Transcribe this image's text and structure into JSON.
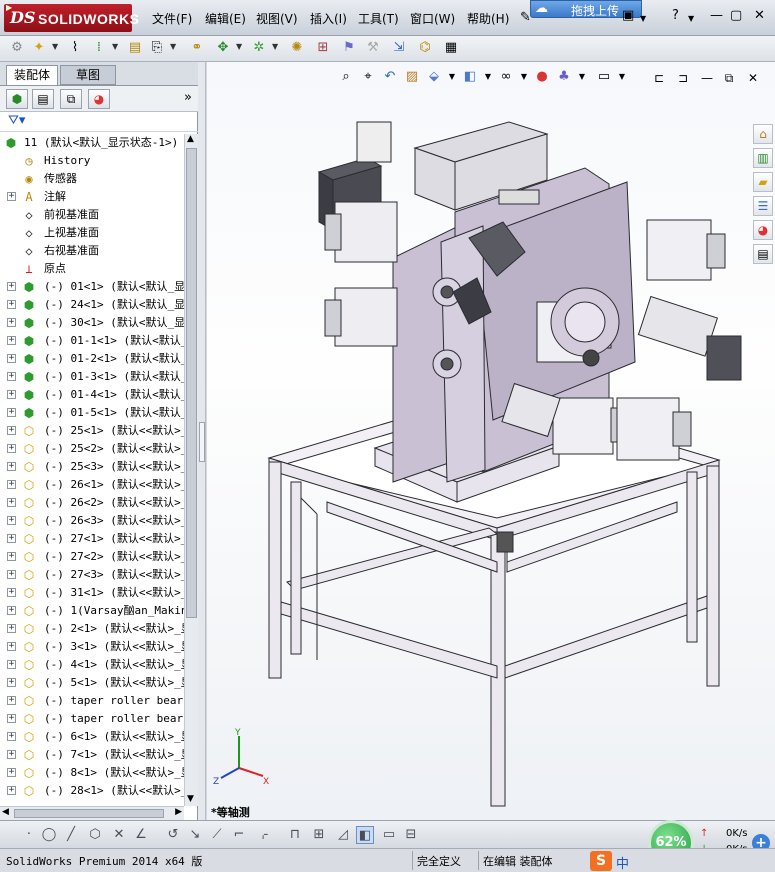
{
  "app": {
    "logo_ds": "DS",
    "logo_name": "SOLIDWORKS"
  },
  "menu": [
    {
      "label": "文件(F)"
    },
    {
      "label": "编辑(E)"
    },
    {
      "label": "视图(V)"
    },
    {
      "label": "插入(I)"
    },
    {
      "label": "工具(T)"
    },
    {
      "label": "窗口(W)"
    },
    {
      "label": "帮助(H)"
    }
  ],
  "upload_widget": {
    "label": "拖拽上传"
  },
  "title_controls": {
    "help": "?",
    "minimize": "—",
    "restore": "▢",
    "close": "✕"
  },
  "left_tabs": {
    "assembly": "装配体",
    "sketch": "草图"
  },
  "tree": {
    "root": "11  (默认<默认_显示状态-1>)",
    "items": [
      {
        "expand": "",
        "icon": "history-icon",
        "label": "History"
      },
      {
        "expand": "",
        "icon": "sensor-icon",
        "label": "传感器"
      },
      {
        "expand": "+",
        "icon": "annotation-icon",
        "label": "注解"
      },
      {
        "expand": "",
        "icon": "plane-icon",
        "label": "前视基准面"
      },
      {
        "expand": "",
        "icon": "plane-icon",
        "label": "上视基准面"
      },
      {
        "expand": "",
        "icon": "plane-icon",
        "label": "右视基准面"
      },
      {
        "expand": "",
        "icon": "origin-icon",
        "label": "原点"
      },
      {
        "expand": "+",
        "icon": "subassembly-icon",
        "label": "(-) 01<1> (默认<默认_显"
      },
      {
        "expand": "+",
        "icon": "subassembly-icon",
        "label": "(-) 24<1> (默认<默认_显"
      },
      {
        "expand": "+",
        "icon": "subassembly-icon",
        "label": "(-) 30<1> (默认<默认_显"
      },
      {
        "expand": "+",
        "icon": "subassembly-icon",
        "label": "(-) 01-1<1> (默认<默认_"
      },
      {
        "expand": "+",
        "icon": "subassembly-icon",
        "label": "(-) 01-2<1> (默认<默认_"
      },
      {
        "expand": "+",
        "icon": "subassembly-icon",
        "label": "(-) 01-3<1> (默认<默认_"
      },
      {
        "expand": "+",
        "icon": "subassembly-icon",
        "label": "(-) 01-4<1> (默认<默认_"
      },
      {
        "expand": "+",
        "icon": "subassembly-icon",
        "label": "(-) 01-5<1> (默认<默认_"
      },
      {
        "expand": "+",
        "icon": "part-icon",
        "label": "(-) 25<1> (默认<<默认>_"
      },
      {
        "expand": "+",
        "icon": "part-icon",
        "label": "(-) 25<2> (默认<<默认>_"
      },
      {
        "expand": "+",
        "icon": "part-icon",
        "label": "(-) 25<3> (默认<<默认>_"
      },
      {
        "expand": "+",
        "icon": "part-icon",
        "label": "(-) 26<1> (默认<<默认>_"
      },
      {
        "expand": "+",
        "icon": "part-icon",
        "label": "(-) 26<2> (默认<<默认>_"
      },
      {
        "expand": "+",
        "icon": "part-icon",
        "label": "(-) 26<3> (默认<<默认>_"
      },
      {
        "expand": "+",
        "icon": "part-icon",
        "label": "(-) 27<1> (默认<<默认>_"
      },
      {
        "expand": "+",
        "icon": "part-icon",
        "label": "(-) 27<2> (默认<<默认>_"
      },
      {
        "expand": "+",
        "icon": "part-icon",
        "label": "(-) 27<3> (默认<<默认>_"
      },
      {
        "expand": "+",
        "icon": "part-icon",
        "label": "(-) 31<1> (默认<<默认>_"
      },
      {
        "expand": "+",
        "icon": "part-icon",
        "label": "(-) 1(Varsay酗an_Makine"
      },
      {
        "expand": "+",
        "icon": "part-icon",
        "label": "(-) 2<1> (默认<<默认>_显"
      },
      {
        "expand": "+",
        "icon": "part-icon",
        "label": "(-) 3<1> (默认<<默认>_显"
      },
      {
        "expand": "+",
        "icon": "part-icon",
        "label": "(-) 4<1> (默认<<默认>_显"
      },
      {
        "expand": "+",
        "icon": "part-icon",
        "label": "(-) 5<1> (默认<<默认>_显"
      },
      {
        "expand": "+",
        "icon": "part-icon",
        "label": "(-) taper roller bearin"
      },
      {
        "expand": "+",
        "icon": "part-icon",
        "label": "(-) taper roller bearin"
      },
      {
        "expand": "+",
        "icon": "part-icon",
        "label": "(-) 6<1> (默认<<默认>_显"
      },
      {
        "expand": "+",
        "icon": "part-icon",
        "label": "(-) 7<1> (默认<<默认>_显"
      },
      {
        "expand": "+",
        "icon": "part-icon",
        "label": "(-) 8<1> (默认<<默认>_显"
      },
      {
        "expand": "+",
        "icon": "part-icon",
        "label": "(-) 28<1> (默认<<默认>_"
      }
    ]
  },
  "viewport": {
    "view_label": "*等轴测",
    "triad": {
      "x": "X",
      "y": "Y",
      "z": "Z"
    }
  },
  "status": {
    "version": "SolidWorks Premium 2014 x64 版",
    "definition": "完全定义",
    "edit_mode": "在编辑 装配体"
  },
  "system_tray": {
    "ime_brand": "S",
    "ime_lang": "中",
    "net_percent": "62%",
    "upload_speed": "0K/s",
    "download_speed": "0K/s"
  },
  "colors": {
    "brand_red": "#b0141c",
    "model_plate": "#c9c0d4",
    "model_frame": "#e6e1ec",
    "model_dark": "#3c3c44"
  }
}
